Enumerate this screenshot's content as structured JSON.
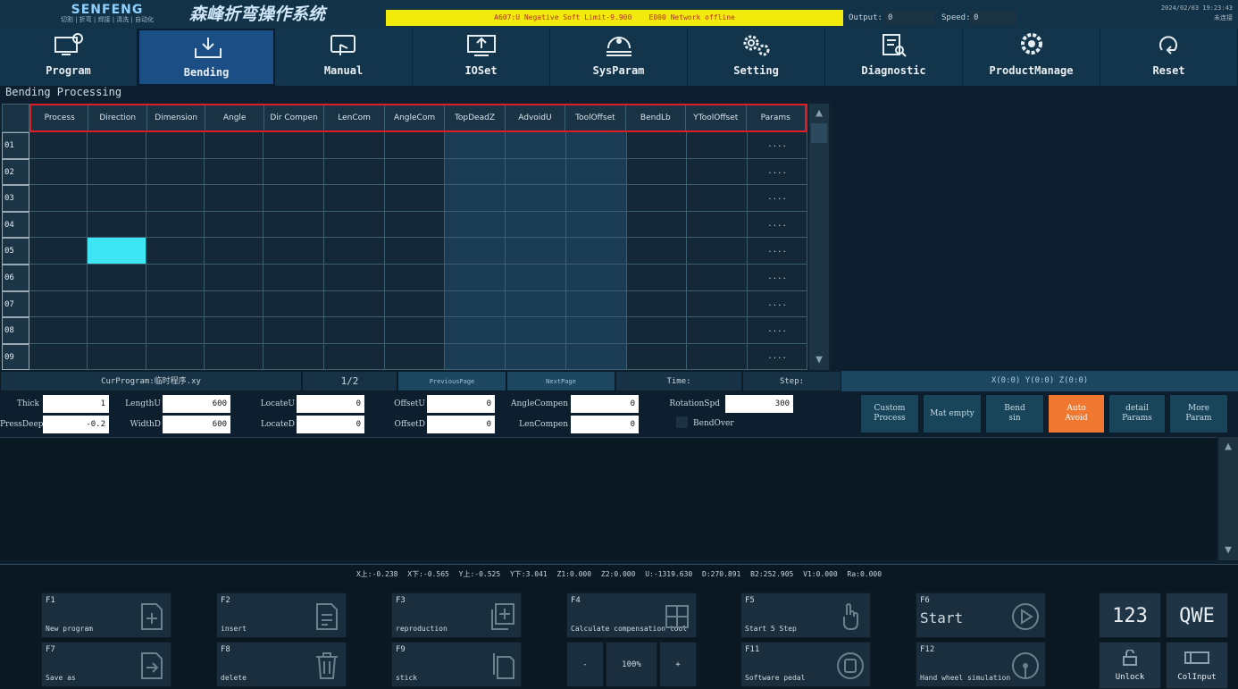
{
  "header": {
    "logo_text": "SENFENG",
    "logo_subtext": "切割 | 折弯 | 焊接 | 清洗 | 自动化",
    "system_title": "森峰折弯操作系统",
    "alarm_text": "A607:U Negative Soft Limit-9.900    E000 Network offline",
    "output_label": "Output:",
    "output_value": "0",
    "speed_label": "Speed:",
    "speed_value": "0",
    "date": "2024/02/03 19:23:43",
    "user": "未连接"
  },
  "nav": [
    {
      "label": "Program",
      "icon": "program-icon"
    },
    {
      "label": "Bending",
      "icon": "bending-icon",
      "active": true
    },
    {
      "label": "Manual",
      "icon": "manual-icon"
    },
    {
      "label": "IOSet",
      "icon": "ioset-icon"
    },
    {
      "label": "SysParam",
      "icon": "sysparam-icon"
    },
    {
      "label": "Setting",
      "icon": "gear-icon"
    },
    {
      "label": "Diagnostic",
      "icon": "diagnostic-icon"
    },
    {
      "label": "ProductManage",
      "icon": "productmanage-icon"
    },
    {
      "label": "Reset",
      "icon": "reset-icon"
    }
  ],
  "section_title": "Bending Processing",
  "table": {
    "columns": [
      "Process",
      "Direction",
      "Dimension",
      "Angle",
      "Dir Compen",
      "LenCom",
      "AngleCom",
      "TopDeadZ",
      "AdvoidU",
      "ToolOffset",
      "BendLb",
      "YToolOffset",
      "Params"
    ],
    "rows": [
      "01",
      "02",
      "03",
      "04",
      "05",
      "06",
      "07",
      "08",
      "09"
    ],
    "params_cell": "....",
    "selected_cell": {
      "row": 4,
      "col": 1
    }
  },
  "info": {
    "cur_program": "CurProgram:临时程序.xy",
    "page": "1/2",
    "prev": "PreviousPage",
    "next": "NextPage",
    "time": "Time:",
    "step": "Step:",
    "coords": "X(0:0) Y(0:0) Z(0:0)"
  },
  "params": {
    "thick_label": "Thick",
    "thick": "1",
    "pressdeep_label": "PressDeep",
    "pressdeep": "-0.2",
    "lengthu_label": "LengthU",
    "lengthu": "600",
    "widthd_label": "WidthD",
    "widthd": "600",
    "locateu_label": "LocateU",
    "locateu": "0",
    "located_label": "LocateD",
    "located": "0",
    "offsetu_label": "OffsetU",
    "offsetu": "0",
    "offsetd_label": "OffsetD",
    "offsetd": "0",
    "anglecompen_label": "AngleCompen",
    "anglecompen": "0",
    "lencompen_label": "LenCompen",
    "lencompen": "0",
    "rotationspd_label": "RotationSpd",
    "rotationspd": "300",
    "bendover_label": "BendOver"
  },
  "actions": [
    {
      "label": "Custom\nProcess"
    },
    {
      "label": "Mat empty"
    },
    {
      "label": "Bend\nsin"
    },
    {
      "label": "Auto\nAvoid",
      "active": true
    },
    {
      "label": "detail\nParams"
    },
    {
      "label": "More\nParam"
    }
  ],
  "status": "X上:-0.238 X下:-0.565 Y上:-0.525 Y下:3.041 Z1:0.000 Z2:0.000 U:-1319.630 D:270.891 B2:252.905 V1:0.000 Ra:0.000",
  "fkeys": [
    {
      "key": "F1",
      "label": "New program",
      "icon": "add-file-icon"
    },
    {
      "key": "F2",
      "label": "insert",
      "icon": "insert-icon"
    },
    {
      "key": "F3",
      "label": "reproduction",
      "icon": "copy-add-icon"
    },
    {
      "key": "F4",
      "label": "Calculate compensation tool",
      "icon": "grid-icon"
    },
    {
      "key": "F5",
      "label": "Start 5 Step",
      "icon": "hand-icon"
    },
    {
      "key": "F6",
      "label": "Start",
      "icon": "play-icon"
    },
    {
      "key": "F7",
      "label": "Save as",
      "icon": "save-as-icon"
    },
    {
      "key": "F8",
      "label": "delete",
      "icon": "trash-icon"
    },
    {
      "key": "F9",
      "label": "stick",
      "icon": "paste-icon"
    },
    {
      "key": "F11",
      "label": "Software pedal",
      "icon": "pedal-icon"
    },
    {
      "key": "F12",
      "label": "Hand wheel simulation",
      "icon": "handwheel-icon"
    }
  ],
  "zoom": {
    "minus": "-",
    "value": "100%",
    "plus": "+"
  },
  "keyboard": {
    "num": "123",
    "alpha": "QWE",
    "unlock": "Unlock",
    "colinput": "ColInput"
  },
  "colors": {
    "accent": "#1b4e85",
    "alarm_bg": "#f2ea0a",
    "header_outline": "#e01d24",
    "selected_cell": "#3de6f2",
    "auto_avoid": "#f0772f"
  }
}
